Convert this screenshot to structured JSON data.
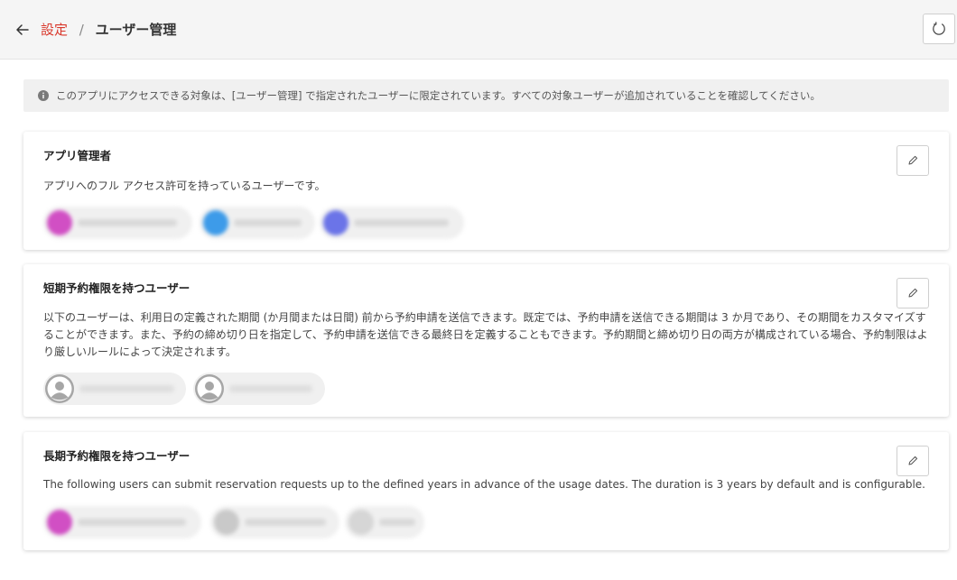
{
  "header": {
    "breadcrumb_link": "設定",
    "breadcrumb_separator": "/",
    "breadcrumb_current": "ユーザー管理"
  },
  "notice": {
    "text": "このアプリにアクセスできる対象は、[ユーザー管理] で指定されたユーザーに限定されています。すべての対象ユーザーが追加されていることを確認してください。"
  },
  "sections": [
    {
      "title": "アプリ管理者",
      "description": "アプリへのフル アクセス許可を持っているユーザーです。"
    },
    {
      "title": "短期予約権限を持つユーザー",
      "description": "以下のユーザーは、利用日の定義された期間 (か月間または日間) 前から予約申請を送信できます。既定では、予約申請を送信できる期間は 3 か月であり、その期間をカスタマイズすることができます。また、予約の締め切り日を指定して、予約申請を送信できる最終日を定義することもできます。予約期間と締め切り日の両方が構成されている場合、予約制限はより厳しいルールによって決定されます。"
    },
    {
      "title": "長期予約権限を持つユーザー",
      "description": "The following users can submit reservation requests up to the defined years in advance of the usage dates. The duration is 3 years by default and is configurable."
    }
  ],
  "colors": {
    "accent": "#d9372b",
    "avatar_magenta": "#d14fc4",
    "avatar_blue": "#3d9be9",
    "avatar_indigo": "#6b74e8"
  },
  "icons": {
    "back": "arrow-left-icon",
    "refresh": "refresh-icon",
    "info": "info-icon",
    "edit": "pencil-icon",
    "default_avatar": "user-avatar-icon"
  }
}
